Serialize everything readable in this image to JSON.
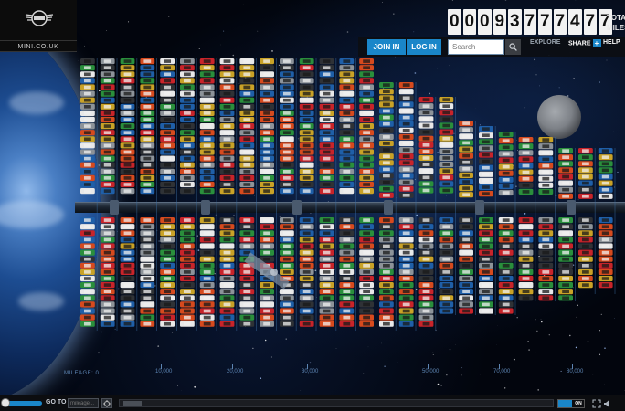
{
  "brand": {
    "url": "MINI.CO.UK"
  },
  "counter": {
    "digits": "00093777477",
    "label_line1": "TOTAL",
    "label_line2": "MILES"
  },
  "nav": {
    "join_label": "JOIN IN",
    "login_label": "LOG IN",
    "search_placeholder": "Search",
    "explore_label": "EXPLORE",
    "share_label": "SHARE",
    "share_plus": "+",
    "help_label": "HELP"
  },
  "axis": {
    "title": "MILEAGE: 0",
    "ticks": [
      "10,000",
      "20,000",
      "30,000",
      "50,000",
      "70,000",
      "80,000"
    ]
  },
  "bottom": {
    "goto_label": "GO TO",
    "mileage_placeholder": "mileage...",
    "toggle_on": "ON"
  },
  "colors": {
    "accent": "#1a86c9",
    "car_palette": [
      "#c8242a",
      "#e8e8e8",
      "#2f3236",
      "#1f5fa8",
      "#c9a227",
      "#8d9399",
      "#d64a1e",
      "#2a8f3c"
    ]
  }
}
